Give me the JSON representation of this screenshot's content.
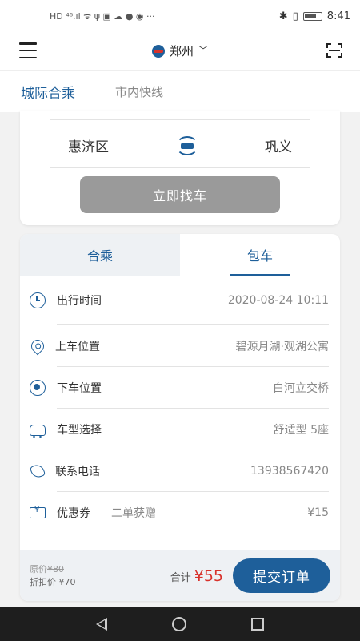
{
  "status_bar": {
    "left_text": "HD ⁴⁶.ıl ᯤ ψ ▣ ☁ ● ◉ ···",
    "time": "8:41"
  },
  "header": {
    "city": "郑州",
    "chevron": "﹀",
    "icons": {
      "menu": "menu-icon",
      "scan": "scan-icon",
      "logo": "app-logo-icon"
    }
  },
  "top_tabs": [
    {
      "label": "城际合乘",
      "active": true
    },
    {
      "label": "市内快线",
      "active": false
    }
  ],
  "route": {
    "from": "惠济区",
    "to": "巩义",
    "find_button": "立即找车"
  },
  "mode_tabs": [
    {
      "label": "合乘",
      "active": false
    },
    {
      "label": "包车",
      "active": true
    }
  ],
  "form": [
    {
      "icon": "clock-icon",
      "label": "出行时间",
      "value": "2020-08-24 10:11"
    },
    {
      "icon": "location-pin-icon",
      "label": "上车位置",
      "value": "碧源月湖·观湖公寓"
    },
    {
      "icon": "target-icon",
      "label": "下车位置",
      "value": "白河立交桥"
    },
    {
      "icon": "car-icon",
      "label": "车型选择",
      "value": "舒适型 5座"
    },
    {
      "icon": "phone-icon",
      "label": "联系电话",
      "value": "13938567420"
    },
    {
      "icon": "coupon-icon",
      "label": "优惠券",
      "sub": "二单获赠",
      "value": "¥15"
    }
  ],
  "summary": {
    "original_label": "原价",
    "original_price": "¥80",
    "discount_label": "折扣价",
    "discount_price": "¥70",
    "total_label": "合计",
    "total_amount": "¥55",
    "submit_button": "提交订单"
  },
  "colors": {
    "brand": "#1e5f9a",
    "price": "#d8322b",
    "disabled_button": "#9a9a9a"
  }
}
